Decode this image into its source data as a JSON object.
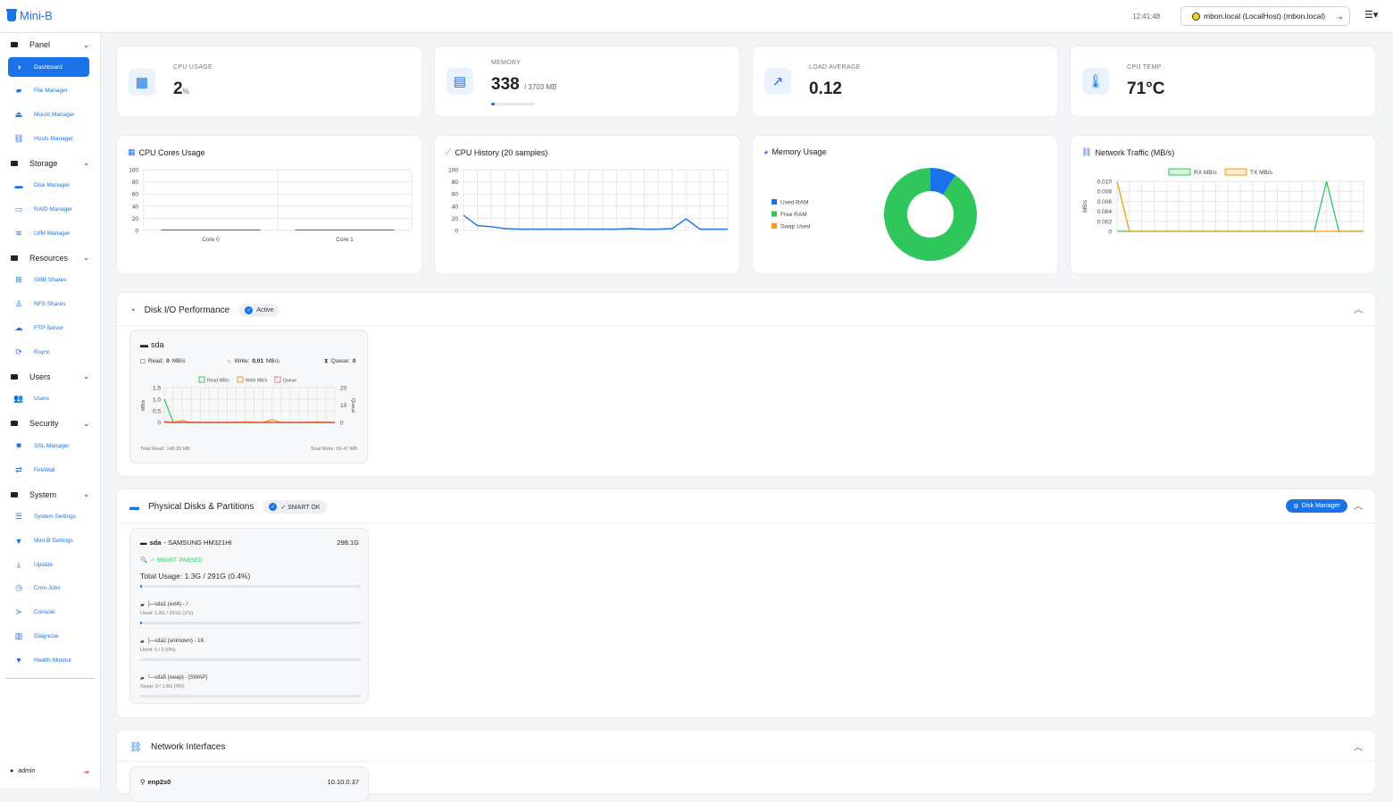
{
  "app": {
    "title": "Mini-B",
    "clock": "12:41:48",
    "host": "mbon.local (LocalHost) (mbon.local)",
    "user": "admin"
  },
  "colors": {
    "accent": "#1a73e8",
    "green": "#2fc65c",
    "orange": "#f39c12",
    "red": "#e53935"
  },
  "sidebar": {
    "groups": [
      {
        "label": "Panel",
        "items": [
          {
            "label": "Dashboard",
            "icon": "dashboard-icon",
            "active": true
          },
          {
            "label": "File Manager",
            "icon": "folder-open-icon"
          },
          {
            "label": "Mount Manager",
            "icon": "eject-icon"
          },
          {
            "label": "Hosts Manager",
            "icon": "network-icon"
          }
        ]
      },
      {
        "label": "Storage",
        "items": [
          {
            "label": "Disk Manager",
            "icon": "hdd-icon"
          },
          {
            "label": "RAID Manager",
            "icon": "raid-icon"
          },
          {
            "label": "LVM Manager",
            "icon": "layers-icon"
          }
        ]
      },
      {
        "label": "Resources",
        "items": [
          {
            "label": "SMB Shares",
            "icon": "windows-icon"
          },
          {
            "label": "NFS Shares",
            "icon": "linux-icon"
          },
          {
            "label": "FTP Server",
            "icon": "cloud-upload-icon"
          },
          {
            "label": "Rsync",
            "icon": "sync-icon"
          }
        ]
      },
      {
        "label": "Users",
        "items": [
          {
            "label": "Users",
            "icon": "users-icon"
          }
        ]
      },
      {
        "label": "Security",
        "items": [
          {
            "label": "SSL Manager",
            "icon": "certificate-icon"
          },
          {
            "label": "FireWall",
            "icon": "arrows-icon"
          }
        ]
      },
      {
        "label": "System",
        "items": [
          {
            "label": "System Settings",
            "icon": "sliders-icon"
          },
          {
            "label": "Mini-B Settings",
            "icon": "bucket-icon"
          },
          {
            "label": "Update",
            "icon": "download-icon"
          },
          {
            "label": "Cron Jobs",
            "icon": "clock-icon"
          },
          {
            "label": "Console",
            "icon": "terminal-icon"
          },
          {
            "label": "Diagnose",
            "icon": "chart-icon"
          },
          {
            "label": "Health Monitor",
            "icon": "heartbeat-icon"
          }
        ]
      }
    ]
  },
  "stats": {
    "cpu": {
      "label": "CPU USAGE",
      "value": "2",
      "unit": "%"
    },
    "memory": {
      "label": "MEMORY",
      "value": "338",
      "unit": "/ 3703 MB",
      "fraction": 0.091
    },
    "load": {
      "label": "LOAD AVERAGE",
      "value": "0.12"
    },
    "temp": {
      "label": "CPU TEMP",
      "value": "71°C"
    }
  },
  "chart_data": [
    {
      "type": "bar",
      "title": "CPU Cores Usage",
      "categories": [
        "Core 0",
        "Core 1"
      ],
      "values": [
        1,
        1
      ],
      "ylim": [
        0,
        100
      ],
      "yticks": [
        "100",
        "80",
        "60",
        "40",
        "20",
        "0"
      ]
    },
    {
      "type": "line",
      "title": "CPU History (20 samples)",
      "ylim": [
        0,
        100
      ],
      "yticks": [
        "100",
        "80",
        "60",
        "40",
        "20",
        "0"
      ],
      "values": [
        25,
        8,
        6,
        3,
        2,
        2,
        2,
        2,
        2,
        2,
        2,
        2,
        3,
        2,
        2,
        3,
        19,
        2,
        2,
        2
      ]
    },
    {
      "type": "pie",
      "title": "Memory Usage",
      "legend": [
        "Used RAM",
        "Free RAM",
        "Swap Used"
      ],
      "values": [
        9.1,
        90.9,
        0
      ]
    },
    {
      "type": "line",
      "title": "Network Traffic (MB/s)",
      "ylabel": "MB/s",
      "ylim": [
        0,
        0.01
      ],
      "yticks": [
        "0.010",
        "0.008",
        "0.006",
        "0.004",
        "0.002",
        "0"
      ],
      "series": [
        {
          "name": "RX MB/s",
          "values": [
            0,
            0,
            0,
            0,
            0,
            0,
            0,
            0,
            0,
            0,
            0,
            0,
            0,
            0,
            0,
            0,
            0,
            0.01,
            0,
            0,
            0
          ]
        },
        {
          "name": "TX MB/s",
          "values": [
            0.01,
            0,
            0,
            0,
            0,
            0,
            0,
            0,
            0,
            0,
            0,
            0,
            0,
            0,
            0,
            0,
            0,
            0,
            0,
            0,
            0
          ]
        }
      ]
    },
    {
      "type": "line",
      "title": "sda",
      "ylabel": "MB/s",
      "y2label": "Queue",
      "ylim": [
        0,
        1.5
      ],
      "y2lim": [
        0,
        20
      ],
      "yticks": [
        "1.5",
        "1.0",
        "0.5",
        "0"
      ],
      "y2ticks": [
        "20",
        "10",
        "0"
      ],
      "series": [
        {
          "name": "Read MB/s",
          "values": [
            1.0,
            0,
            0,
            0,
            0,
            0,
            0,
            0,
            0,
            0,
            0,
            0,
            0,
            0,
            0,
            0,
            0,
            0,
            0,
            0
          ]
        },
        {
          "name": "Write MB/s",
          "values": [
            0.05,
            0,
            0.08,
            0,
            0,
            0,
            0,
            0,
            0,
            0.03,
            0,
            0,
            0.12,
            0,
            0,
            0,
            0,
            0.02,
            0,
            0
          ]
        },
        {
          "name": "Queue",
          "values": [
            0,
            0,
            0,
            0,
            0,
            0,
            0,
            0,
            0,
            0,
            0,
            0,
            0,
            0,
            0,
            0,
            0,
            0,
            0,
            0
          ]
        }
      ]
    }
  ],
  "disk_io": {
    "title": "Disk I/O Performance",
    "status": "Active",
    "device": "sda",
    "read_label": "Read:",
    "read": "0",
    "read_unit": "MB/s",
    "write_label": "Write:",
    "write": "0.01",
    "write_unit": "MB/s",
    "queue_label": "Queue:",
    "queue": "0",
    "total_read": "Total Read: 148.39 MB",
    "total_write": "Total Write: 59.47 MB"
  },
  "disks": {
    "title": "Physical Disks & Partitions",
    "status": "✓ SMART OK",
    "button": "Disk Manager",
    "device": "sda",
    "model": "- SAMSUNG HM321HI",
    "size": "298.1G",
    "smart": "✓ SMART: PASSED",
    "usage": "Total Usage: 1.3G / 291G (0.4%)",
    "usage_fraction": 0.004,
    "partitions": [
      {
        "name": "├─sda1 (ext4) - /",
        "used": "Used: 1.3G / 291G (1%)",
        "fraction": 0.01
      },
      {
        "name": "├─sda2 (unknown) - 1K",
        "used": "Used: 0 / 0 (0%)",
        "fraction": 0
      },
      {
        "name": "└─sda5 (swap) - [SWAP]",
        "used": "Swap: 0 / 1.8G (0%)",
        "fraction": 0
      }
    ]
  },
  "network": {
    "title": "Network Interfaces",
    "iface": "enp2s0",
    "ip": "10.10.0.37"
  }
}
